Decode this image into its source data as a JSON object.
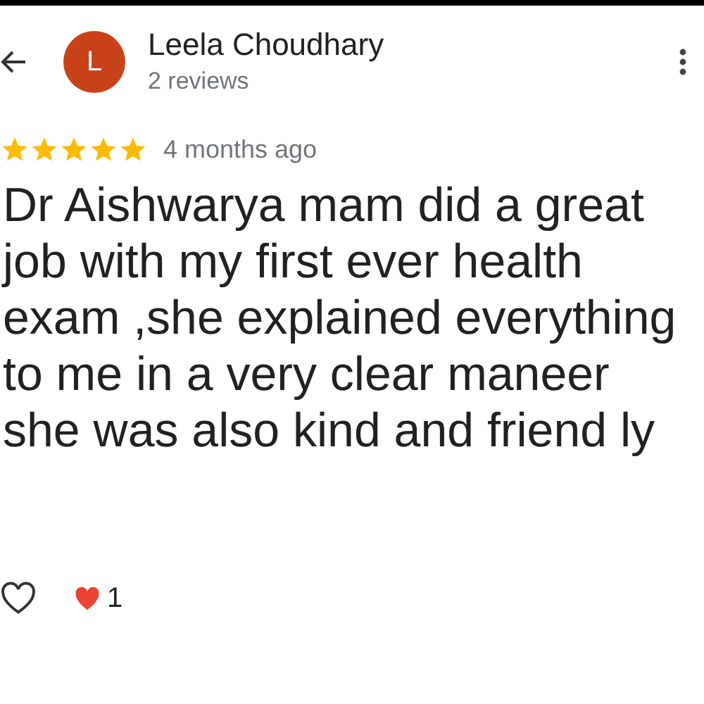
{
  "reviewer": {
    "initial": "L",
    "name": "Leela Choudhary",
    "reviews": "2 reviews"
  },
  "review": {
    "stars": 5,
    "time": "4 months ago",
    "lines": [
      "Dr Aishwarya mam did a great",
      "job with my first ever health",
      "exam ,she explained everything",
      "to me in a very clear maneer",
      "she was also kind and friend ly"
    ]
  },
  "likes": {
    "liked": false,
    "count": "1"
  }
}
